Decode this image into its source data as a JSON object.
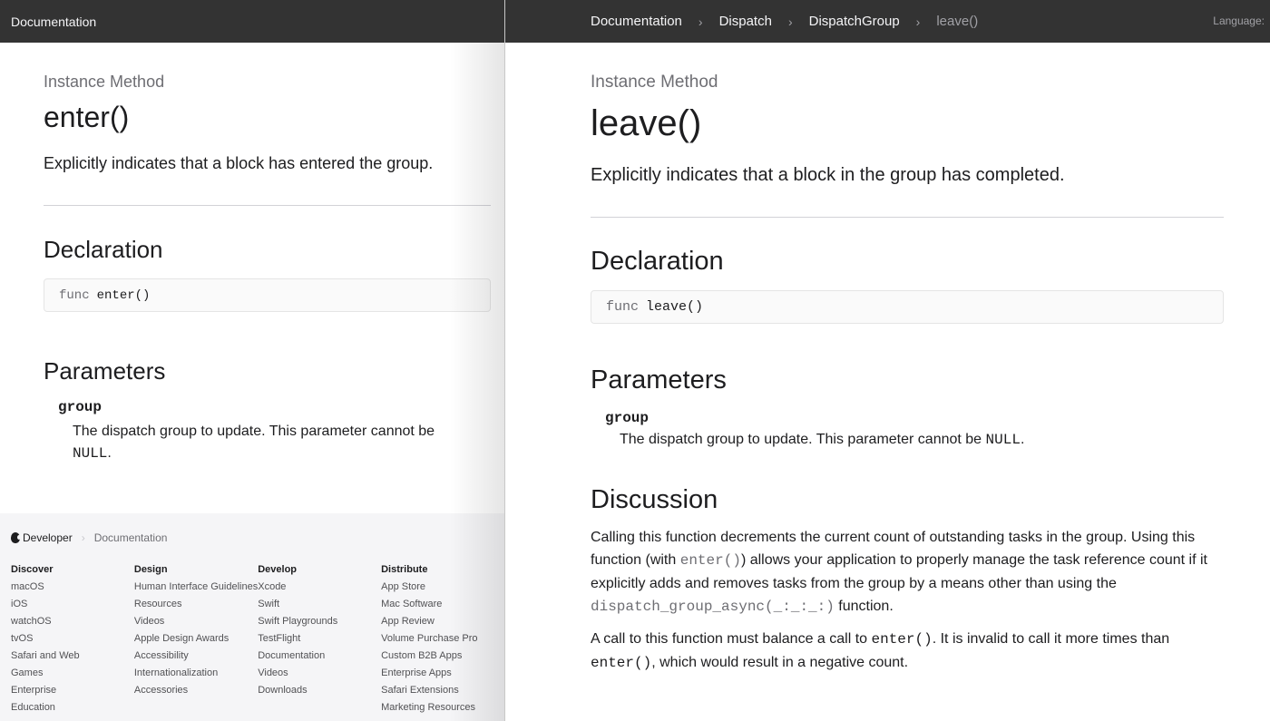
{
  "left": {
    "nav": {
      "title": "Documentation"
    },
    "eyebrow": "Instance Method",
    "title": "enter()",
    "abstract": "Explicitly indicates that a block has entered the group.",
    "declaration_heading": "Declaration",
    "declaration_keyword": "func",
    "declaration_name": "enter()",
    "parameters_heading": "Parameters",
    "param_name": "group",
    "param_desc_text": "The dispatch group to update. This parameter cannot be",
    "param_desc_code": "NULL",
    "param_desc_end": ".",
    "footer": {
      "brand": "Developer",
      "crumb": "Documentation",
      "columns": [
        {
          "title": "Discover",
          "items": [
            "macOS",
            "iOS",
            "watchOS",
            "tvOS",
            "Safari and Web",
            "Games",
            "Enterprise",
            "Education"
          ]
        },
        {
          "title": "Design",
          "items": [
            "Human Interface Guidelines",
            "Resources",
            "Videos",
            "Apple Design Awards",
            "Accessibility",
            "Internationalization",
            "Accessories"
          ]
        },
        {
          "title": "Develop",
          "items": [
            "Xcode",
            "Swift",
            "Swift Playgrounds",
            "TestFlight",
            "Documentation",
            "Videos",
            "Downloads"
          ]
        },
        {
          "title": "Distribute",
          "items": [
            "App Store",
            "Mac Software",
            "App Review",
            "Volume Purchase Pro",
            "Custom B2B Apps",
            "Enterprise Apps",
            "Safari Extensions",
            "Marketing Resources"
          ]
        }
      ]
    }
  },
  "right": {
    "nav": {
      "crumbs": [
        "Documentation",
        "Dispatch",
        "DispatchGroup"
      ],
      "current": "leave()",
      "language_label": "Language:"
    },
    "eyebrow": "Instance Method",
    "title": "leave()",
    "abstract": "Explicitly indicates that a block in the group has completed.",
    "declaration_heading": "Declaration",
    "declaration_keyword": "func",
    "declaration_name": "leave()",
    "parameters_heading": "Parameters",
    "param_name": "group",
    "param_desc_text": "The dispatch group to update. This parameter cannot be",
    "param_desc_code": "NULL",
    "param_desc_end": ".",
    "discussion_heading": "Discussion",
    "discussion_p1": {
      "t1": "Calling this function decrements the current count of outstanding tasks in the group. Using this function (with ",
      "c1": "enter()",
      "t2": ") allows your application to properly manage the task reference count if it explicitly adds and removes tasks from the group by a means other than using the ",
      "c2": "dispatch_group_async(_:_:_:)",
      "t3": " function."
    },
    "discussion_p2": {
      "t1": "A call to this function must balance a call to ",
      "c1": "enter()",
      "t2": ". It is invalid to call it more times than ",
      "c2": "enter()",
      "t3": ", which would result in a negative count."
    }
  }
}
